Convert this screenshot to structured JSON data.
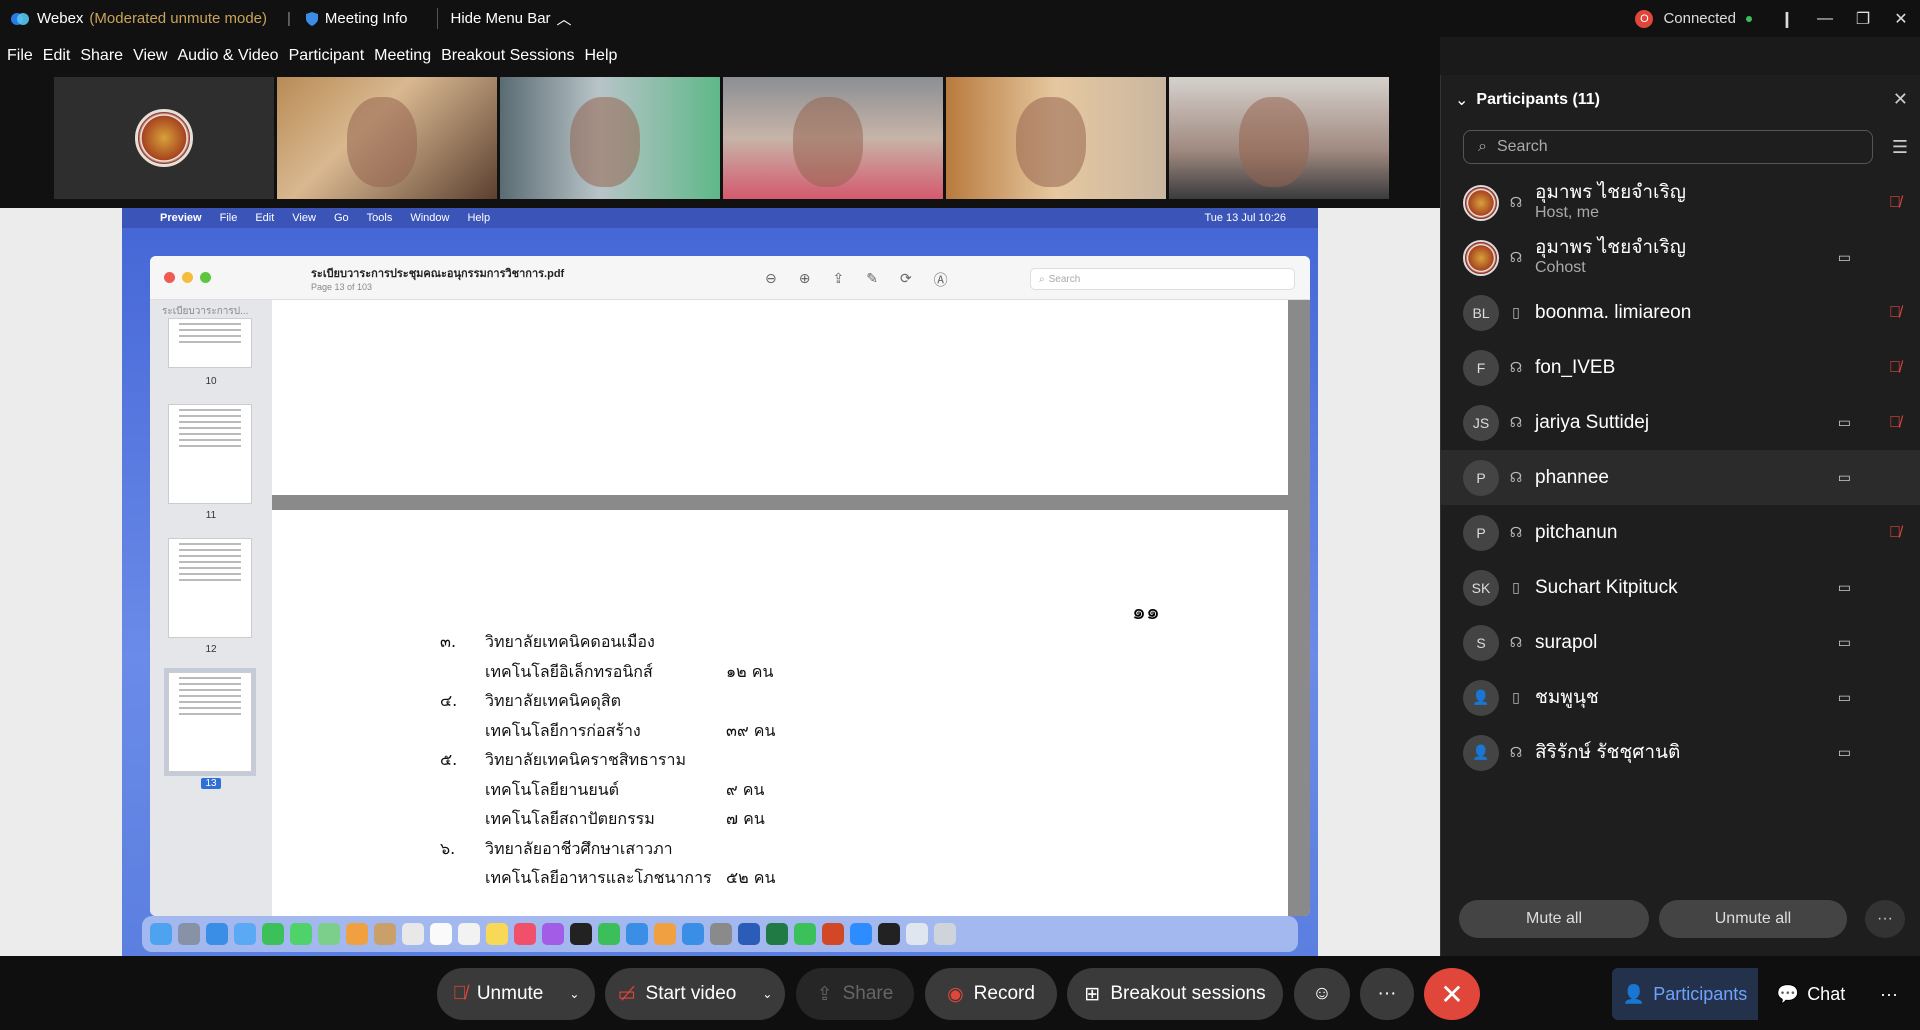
{
  "titlebar": {
    "app_name": "Webex",
    "mode": "(Moderated unmute mode)",
    "meeting_info": "Meeting Info",
    "hide_menu": "Hide Menu Bar",
    "connected": "Connected"
  },
  "menu": [
    "File",
    "Edit",
    "Share",
    "View",
    "Audio & Video",
    "Participant",
    "Meeting",
    "Breakout Sessions",
    "Help"
  ],
  "shared_screen": {
    "mac_menu": [
      "Preview",
      "File",
      "Edit",
      "View",
      "Go",
      "Tools",
      "Window",
      "Help"
    ],
    "clock": "Tue 13 Jul  10:26",
    "doc_name": "ระเบียบวาระการประชุมคณะอนุกรรมการวิชาการ.pdf",
    "doc_page": "Page 13 of 103",
    "search_placeholder": "Search",
    "sidebar_title": "ระเบียบวาระการป...",
    "thumbs": [
      "10",
      "11",
      "12",
      "13"
    ],
    "page_number": "๑๑",
    "lines": [
      {
        "a": "๓.",
        "b": "วิทยาลัยเทคนิคดอนเมือง",
        "c": ""
      },
      {
        "a": "",
        "b": "    เทคโนโลยีอิเล็กทรอนิกส์",
        "c": "๑๒  คน"
      },
      {
        "a": "๔.",
        "b": "วิทยาลัยเทคนิคดุสิต",
        "c": ""
      },
      {
        "a": "",
        "b": "    เทคโนโลยีการก่อสร้าง",
        "c": "๓๙  คน"
      },
      {
        "a": "๕.",
        "b": "วิทยาลัยเทคนิคราชสิทธาราม",
        "c": ""
      },
      {
        "a": "",
        "b": "    เทคโนโลยียานยนต์",
        "c": "   ๙  คน"
      },
      {
        "a": "",
        "b": "    เทคโนโลยีสถาปัตยกรรม",
        "c": "   ๗  คน"
      },
      {
        "a": "๖.",
        "b": "วิทยาลัยอาชีวศึกษาเสาวภา",
        "c": ""
      },
      {
        "a": "",
        "b": "    เทคโนโลยีอาหารและโภชนาการ",
        "c": "๕๒  คน"
      }
    ]
  },
  "participants_panel": {
    "title": "Participants (11)",
    "search_placeholder": "Search",
    "mute_all": "Mute all",
    "unmute_all": "Unmute all",
    "people": [
      {
        "initials": "",
        "name": "อุมาพร ไชยจำเริญ",
        "role": "Host, me"
      },
      {
        "initials": "",
        "name": "อุมาพร ไชยจำเริญ",
        "role": "Cohost"
      },
      {
        "initials": "BL",
        "name": "boonma. limiareon",
        "role": ""
      },
      {
        "initials": "F",
        "name": "fon_IVEB",
        "role": ""
      },
      {
        "initials": "JS",
        "name": "jariya Suttidej",
        "role": ""
      },
      {
        "initials": "P",
        "name": "phannee",
        "role": ""
      },
      {
        "initials": "P",
        "name": "pitchanun",
        "role": ""
      },
      {
        "initials": "SK",
        "name": "Suchart Kitpituck",
        "role": ""
      },
      {
        "initials": "S",
        "name": "surapol",
        "role": ""
      },
      {
        "initials": "",
        "name": "ชมพูนุช",
        "role": ""
      },
      {
        "initials": "",
        "name": "สิริรักษ์ รัชชุศานติ",
        "role": ""
      }
    ]
  },
  "controls": {
    "unmute": "Unmute",
    "start_video": "Start video",
    "share": "Share",
    "record": "Record",
    "breakout": "Breakout sessions",
    "participants": "Participants",
    "chat": "Chat"
  }
}
